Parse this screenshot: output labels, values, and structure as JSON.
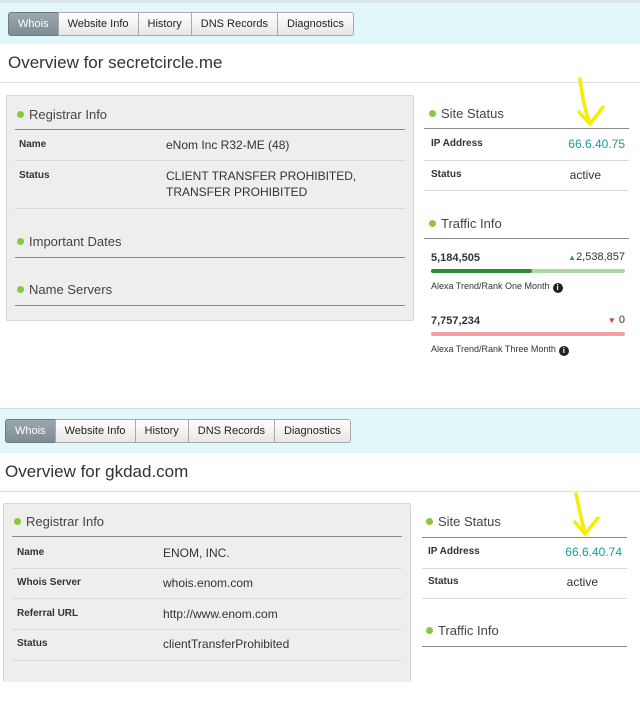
{
  "shot_a": {
    "tabs": [
      "Whois",
      "Website Info",
      "History",
      "DNS Records",
      "Diagnostics"
    ],
    "overview_title": "Overview for secretcircle.me",
    "registrar_info": {
      "title": "Registrar Info",
      "rows": [
        {
          "label": "Name",
          "value": "eNom Inc R32-ME (48)"
        },
        {
          "label": "Status",
          "value_line1": "CLIENT TRANSFER PROHIBITED,",
          "value_line2": "TRANSFER PROHIBITED"
        }
      ]
    },
    "important_dates_title": "Important Dates",
    "name_servers_title": "Name Servers",
    "site_status": {
      "title": "Site Status",
      "ip_label": "IP Address",
      "ip_value": "66.6.40.75",
      "status_label": "Status",
      "status_value": "active"
    },
    "traffic_info": {
      "title": "Traffic Info",
      "one_month": {
        "rank": "5,184,505",
        "delta": "2,538,857",
        "direction": "up",
        "bar_fraction": 0.52,
        "caption": "Alexa Trend/Rank One Month",
        "bar_color": "#2e8b36",
        "track_color": "#a8d9a0"
      },
      "three_month": {
        "rank": "7,757,234",
        "delta": "0",
        "direction": "down",
        "bar_fraction": 0.0,
        "caption": "Alexa Trend/Rank Three Month",
        "bar_color": "#d9342b",
        "track_color": "#f0a0a0"
      }
    },
    "info_icon": "info-icon"
  },
  "shot_b": {
    "tabs": [
      "Whois",
      "Website Info",
      "History",
      "DNS Records",
      "Diagnostics"
    ],
    "overview_title": "Overview for gkdad.com",
    "registrar_info": {
      "title": "Registrar Info",
      "rows": [
        {
          "label": "Name",
          "value": "ENOM, INC."
        },
        {
          "label": "Whois Server",
          "value": "whois.enom.com"
        },
        {
          "label": "Referral URL",
          "value": "http://www.enom.com"
        },
        {
          "label": "Status",
          "value": "clientTransferProhibited"
        }
      ]
    },
    "site_status": {
      "title": "Site Status",
      "ip_label": "IP Address",
      "ip_value": "66.6.40.74",
      "status_label": "Status",
      "status_value": "active"
    },
    "traffic_info": {
      "title": "Traffic Info"
    }
  },
  "colors": {
    "accent_teal": "#1a9b9b",
    "status_dot": "#8cc63f",
    "annotation_arrow": "#f5ee00",
    "tab_bar": "#e2f7fa"
  }
}
